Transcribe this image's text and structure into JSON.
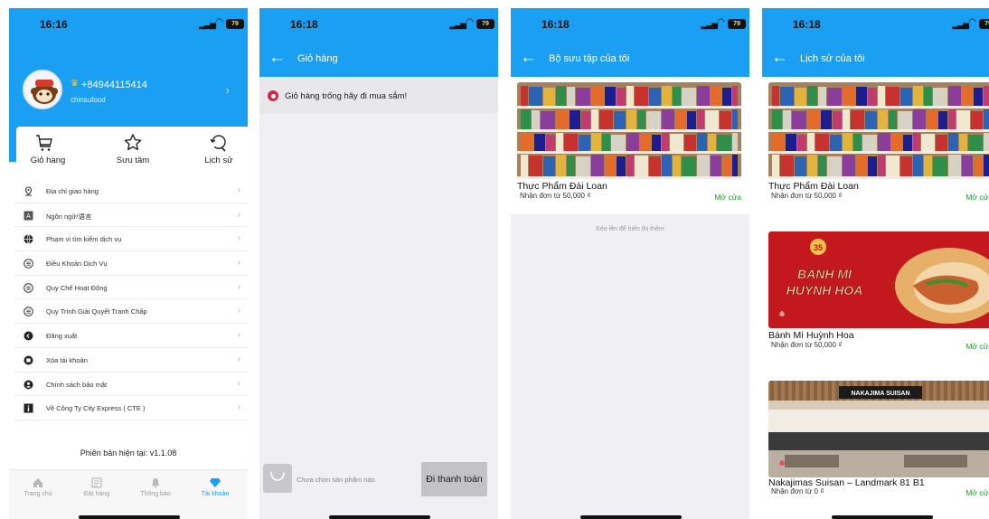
{
  "status": {
    "screen1_time": "16:16",
    "screen2_time": "16:18",
    "screen3_time": "16:18",
    "screen4_time": "16:18",
    "battery": "79"
  },
  "account": {
    "phone": "+84944115414",
    "username": "chinsufood",
    "quick": {
      "cart": "Giỏ hàng",
      "favorites": "Sưu tầm",
      "history": "Lịch sử"
    },
    "menu": [
      {
        "label": "Địa chỉ giao hàng",
        "icon": "location-icon"
      },
      {
        "label": "Ngôn ngữ/语言",
        "icon": "language-icon"
      },
      {
        "label": "Phạm vi tìm kiếm dịch vụ",
        "icon": "globe-icon"
      },
      {
        "label": "Điều Khoản Dịch Vụ",
        "icon": "list-icon"
      },
      {
        "label": "Quy Chế Hoạt Động",
        "icon": "list-icon"
      },
      {
        "label": "Quy Trình Giải Quyết Tranh Chấp",
        "icon": "list-icon"
      },
      {
        "label": "Đăng xuất",
        "icon": "logout-icon"
      },
      {
        "label": "Xóa tài khoản",
        "icon": "delete-account-icon"
      },
      {
        "label": "Chính sách bảo mật",
        "icon": "privacy-icon"
      },
      {
        "label": "Về Công Ty City Express ( CTE )",
        "icon": "info-icon"
      }
    ],
    "version": "Phiên bản hiện tại: v1.1.08"
  },
  "tabbar": {
    "home": "Trang chủ",
    "orders": "Đặt hàng",
    "notifications": "Thông báo",
    "account": "Tài khoản"
  },
  "cart": {
    "title": "Giỏ hàng",
    "empty_message": "Giỏ hàng trống hãy đi mua sắm!",
    "no_selection": "Chưa chọn sản phẩm nào",
    "checkout": "Đi thanh toán"
  },
  "collection": {
    "title": "Bộ sưu tập của tôi",
    "load_more": "Kéo lên để hiển thị thêm",
    "stores": [
      {
        "name": "Thực Phẩm Đài Loan",
        "min_order": "Nhận đơn từ 50,000 ₫",
        "status": "Mở cửa"
      }
    ]
  },
  "history": {
    "title": "Lịch sử của tôi",
    "stores": [
      {
        "name": "Thực Phẩm Đài Loan",
        "min_order": "Nhận đơn từ 50,000 ₫",
        "status": "Mở cửa"
      },
      {
        "name": "Bánh Mì Huỳnh Hoa",
        "min_order": "Nhận đơn từ 50,000 ₫",
        "status": "Mở cửa",
        "banner_text_1": "BÁNH MÌ",
        "banner_text_2": "HUỲNH HOA",
        "badge": "35"
      },
      {
        "name": "Nakajimas Suisan – Landmark 81 B1",
        "min_order": "Nhận đơn từ 0 ₫",
        "status": "Mở cửa",
        "sign": "NAKAJIMA SUISAN"
      }
    ]
  },
  "colors": {
    "brand_blue": "#1b9ff3",
    "open_green": "#1aa12d",
    "cart_dot": "#d3254c"
  }
}
